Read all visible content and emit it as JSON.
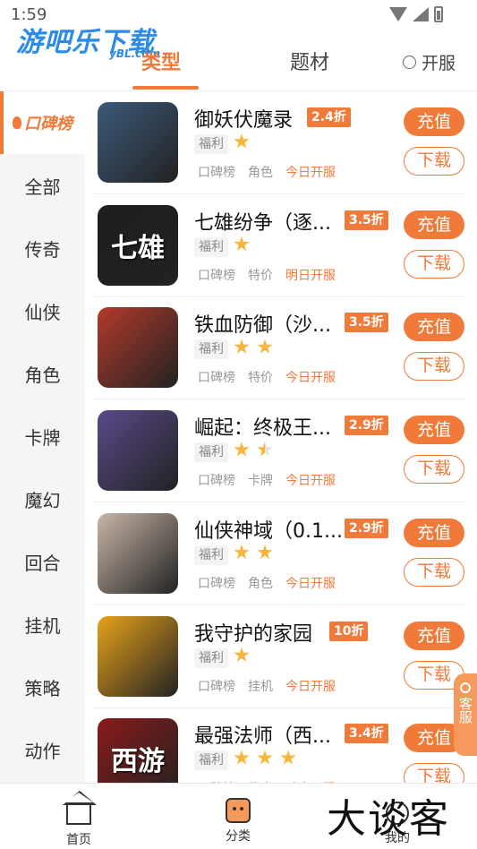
{
  "status_bar": {
    "time": "1:59"
  },
  "watermark": {
    "logo": "游吧乐下载",
    "sub": "yBL.com",
    "bottom": "大谈客"
  },
  "top_tabs": {
    "type": "类型",
    "subject": "题材",
    "server": "开服"
  },
  "sidebar": {
    "items": [
      {
        "label": "口碑榜"
      },
      {
        "label": "全部"
      },
      {
        "label": "传奇"
      },
      {
        "label": "仙侠"
      },
      {
        "label": "角色"
      },
      {
        "label": "卡牌"
      },
      {
        "label": "魔幻"
      },
      {
        "label": "回合"
      },
      {
        "label": "挂机"
      },
      {
        "label": "策略"
      },
      {
        "label": "动作"
      }
    ]
  },
  "buttons": {
    "recharge": "充值",
    "download": "下载"
  },
  "games": [
    {
      "name": "御妖伏魔录",
      "discount": "2.4折",
      "fuli": "福利",
      "stars": 1,
      "tags": [
        "口碑榜",
        "角色"
      ],
      "open": "今日开服",
      "color": "#3c5a7a"
    },
    {
      "name": "七雄纷争（逐...",
      "discount": "3.5折",
      "fuli": "福利",
      "stars": 1,
      "tags": [
        "口碑榜",
        "特价"
      ],
      "open": "明日开服",
      "color": "#1e1e1e",
      "icon_text": "七雄"
    },
    {
      "name": "铁血防御（沙...",
      "discount": "3.5折",
      "fuli": "福利",
      "stars": 2,
      "tags": [
        "口碑榜",
        "特价"
      ],
      "open": "今日开服",
      "color": "#b23a2a"
    },
    {
      "name": "崛起：终极王...",
      "discount": "2.9折",
      "fuli": "福利",
      "stars": 1.5,
      "tags": [
        "口碑榜",
        "卡牌"
      ],
      "open": "今日开服",
      "color": "#5a4a8a"
    },
    {
      "name": "仙侠神域（0.1...",
      "discount": "2.9折",
      "fuli": "福利",
      "stars": 2,
      "tags": [
        "口碑榜",
        "角色"
      ],
      "open": "今日开服",
      "color": "#c9b6a8"
    },
    {
      "name": "我守护的家园",
      "discount": "10折",
      "fuli": "福利",
      "stars": 1,
      "tags": [
        "口碑榜",
        "挂机"
      ],
      "open": "今日开服",
      "color": "#e8a21a"
    },
    {
      "name": "最强法师（西...",
      "discount": "3.4折",
      "fuli": "福利",
      "stars": 3,
      "tags": [
        "口碑榜",
        "传奇"
      ],
      "open": "动态开服",
      "color": "#8a1a1a",
      "icon_text": "西游"
    }
  ],
  "service": {
    "label": "客服"
  },
  "bottom_nav": {
    "home": "首页",
    "category": "分类",
    "mine": "我的"
  },
  "colors": {
    "accent": "#f07a3a",
    "star": "#f7b53a",
    "logo_blue": "#2b8be6"
  }
}
